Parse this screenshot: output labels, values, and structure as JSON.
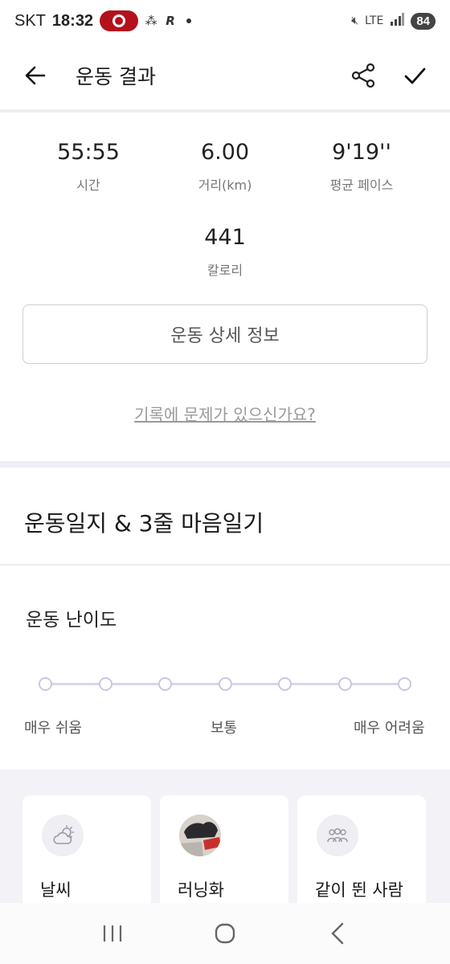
{
  "status_bar": {
    "carrier": "SKT",
    "time": "18:32",
    "network": "LTE",
    "battery": "84"
  },
  "header": {
    "title": "운동 결과"
  },
  "stats": {
    "time": {
      "value": "55:55",
      "label": "시간"
    },
    "distance": {
      "value": "6.00",
      "label": "거리(km)"
    },
    "pace": {
      "value": "9'19''",
      "label": "평균 페이스"
    },
    "calories": {
      "value": "441",
      "label": "칼로리"
    }
  },
  "detail_button": "운동 상세 정보",
  "problem_link": "기록에 문제가 있으신가요?",
  "journal": {
    "title": "운동일지 & 3줄 마음일기"
  },
  "difficulty": {
    "title": "운동 난이도",
    "stops": 7,
    "labels": {
      "easy": "매우 쉬움",
      "normal": "보통",
      "hard": "매우 어려움"
    }
  },
  "cards": [
    {
      "label": "날씨",
      "icon": "cloud-sun-icon"
    },
    {
      "label": "러닝화",
      "icon": "shoe-photo"
    },
    {
      "label": "같이 뛴 사람",
      "icon": "people-icon"
    }
  ]
}
